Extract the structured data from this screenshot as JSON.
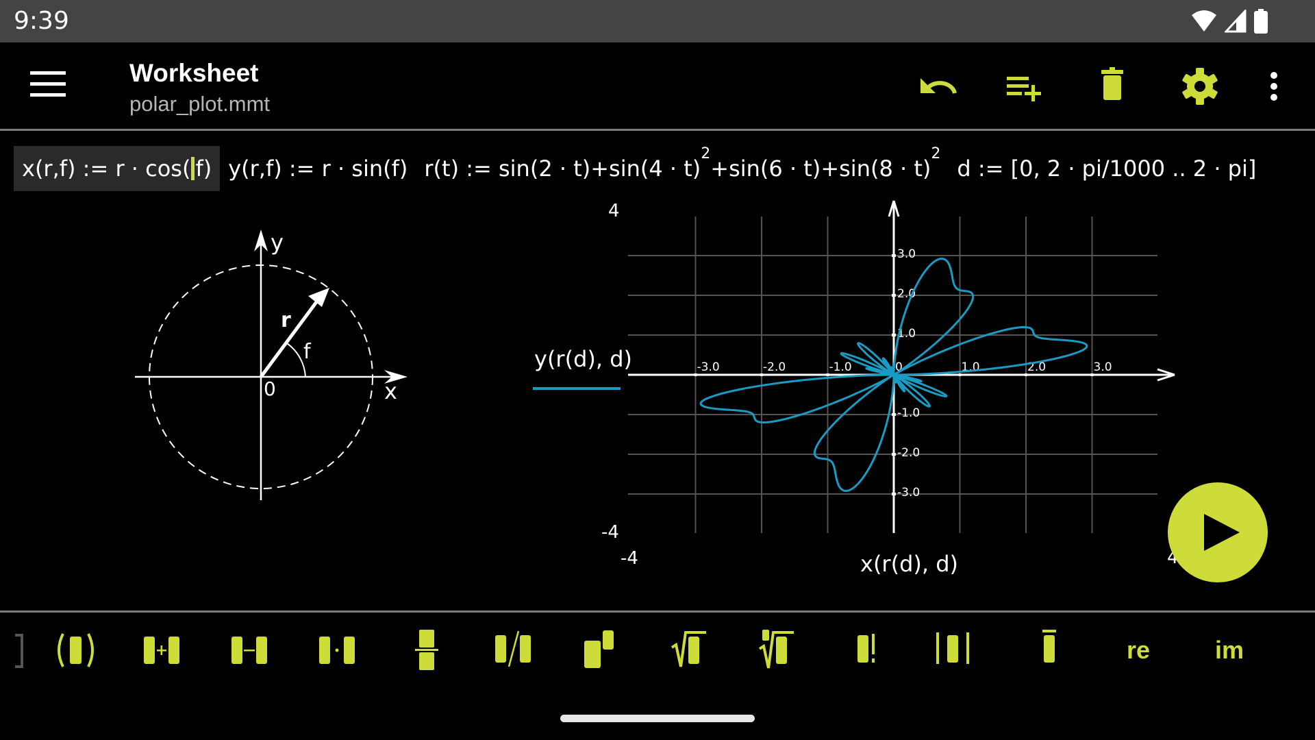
{
  "status_bar": {
    "time": "9:39",
    "icons": [
      "wifi-icon",
      "signal-icon",
      "battery-icon"
    ]
  },
  "app_bar": {
    "title": "Worksheet",
    "subtitle": "polar_plot.mmt",
    "menu_icon": "hamburger-menu-icon",
    "actions": [
      {
        "name": "undo",
        "icon": "undo-icon"
      },
      {
        "name": "add-line",
        "icon": "playlist-add-icon"
      },
      {
        "name": "delete",
        "icon": "trash-icon"
      },
      {
        "name": "settings",
        "icon": "gear-icon"
      },
      {
        "name": "more",
        "icon": "more-vert-icon"
      }
    ],
    "accent_color": "#cddc39"
  },
  "formulas": [
    {
      "id": "x-def",
      "before_caret": "x(r,f) := r · cos(",
      "caret_char": "f",
      "after_caret": ")",
      "active": true
    },
    {
      "id": "y-def",
      "text": "y(r,f) := r · sin(f)"
    },
    {
      "id": "r-def",
      "parts": [
        "r(t) := sin(2 · t)+sin(4 · t)",
        "2",
        "+sin(6 · t)+sin(8 · t)",
        "2"
      ]
    },
    {
      "id": "d-def",
      "text": "d := [0, 2 · pi/1000 .. 2 · pi]"
    }
  ],
  "diagram": {
    "axis_x_label": "x",
    "axis_y_label": "y",
    "origin_label": "0",
    "radius_label": "r",
    "angle_label": "f"
  },
  "plot": {
    "y_axis_title": "y(r(d), d)",
    "x_axis_title": "x(r(d), d)",
    "corner_labels": {
      "y_max": "4",
      "y_min": "-4",
      "x_min": "-4",
      "x_max": "4"
    },
    "series_color": "#1a9bc4"
  },
  "chart_data": {
    "type": "line",
    "title": "",
    "xlabel": "x(r(d), d)",
    "ylabel": "y(r(d), d)",
    "xlim": [
      -4,
      4
    ],
    "ylim": [
      -4,
      4
    ],
    "grid": true,
    "x_ticks": [
      "-3.0",
      "-2.0",
      "-1.0",
      "0",
      "1.0",
      "2.0",
      "3.0"
    ],
    "x_tick_values": [
      -3,
      -2,
      -1,
      0,
      1,
      2,
      3
    ],
    "y_ticks": [
      "3.0",
      "2.0",
      "1.0",
      "-1.0",
      "-2.0",
      "-3.0"
    ],
    "y_tick_values": [
      3,
      2,
      1,
      -1,
      -2,
      -3
    ],
    "legend": [
      {
        "name": "y(r(d), d)",
        "color": "#1a9bc4"
      }
    ],
    "legend_placement": "left",
    "series": [
      {
        "name": "y(r(d), d)",
        "parametric": "polar",
        "r_of_t": "sin(2t)+sin(4t)^2+sin(6t)+sin(8t)^2",
        "t_range": [
          0,
          6.283185
        ],
        "t_steps": 1000,
        "sample_points": [
          {
            "t": 0.0,
            "x": 0.0,
            "y": 0.0
          },
          {
            "t": 0.35,
            "x": 2.85,
            "y": 0.95
          },
          {
            "t": 1.2,
            "x": 0.68,
            "y": 2.88
          },
          {
            "t": 3.49,
            "x": -2.9,
            "y": -0.97
          },
          {
            "t": 4.34,
            "x": -0.68,
            "y": -2.88
          }
        ]
      }
    ]
  },
  "fab": {
    "icon": "play-icon",
    "label": "Run"
  },
  "toolbar": {
    "buttons": [
      {
        "name": "bracket-partial",
        "icon": "bracket-icon"
      },
      {
        "name": "parentheses",
        "icon": "parentheses-icon"
      },
      {
        "name": "add",
        "icon": "plus-operator-icon"
      },
      {
        "name": "subtract",
        "icon": "minus-operator-icon"
      },
      {
        "name": "multiply",
        "icon": "multiply-operator-icon"
      },
      {
        "name": "fraction",
        "icon": "fraction-icon"
      },
      {
        "name": "divide",
        "icon": "divide-slash-icon"
      },
      {
        "name": "power",
        "icon": "power-icon"
      },
      {
        "name": "sqrt",
        "icon": "sqrt-icon"
      },
      {
        "name": "nth-root",
        "icon": "nth-root-icon"
      },
      {
        "name": "factorial",
        "icon": "factorial-icon"
      },
      {
        "name": "abs",
        "icon": "abs-icon"
      },
      {
        "name": "conjugate",
        "icon": "conjugate-icon"
      },
      {
        "name": "re",
        "label": "re"
      },
      {
        "name": "im",
        "label": "im"
      }
    ]
  }
}
